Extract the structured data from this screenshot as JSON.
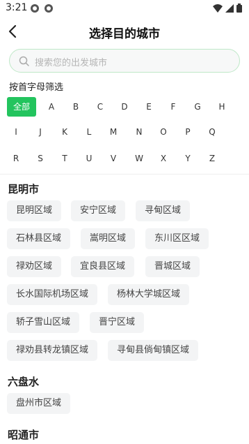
{
  "status": {
    "time": "3:21"
  },
  "header": {
    "title": "选择目的城市"
  },
  "search": {
    "placeholder": "搜索您的出发城市"
  },
  "filter": {
    "title": "按首字母筛选",
    "all_label": "全部",
    "letters": [
      "A",
      "B",
      "C",
      "D",
      "E",
      "F",
      "G",
      "H",
      "I",
      "J",
      "K",
      "L",
      "M",
      "N",
      "O",
      "P",
      "Q",
      "R",
      "S",
      "T",
      "U",
      "V",
      "W",
      "X",
      "Y",
      "Z"
    ]
  },
  "regions": [
    {
      "name": "昆明市",
      "areas": [
        "昆明区域",
        "安宁区域",
        "寻甸区域",
        "石林县区域",
        "嵩明区域",
        "东川区区域",
        "禄劝区域",
        "宜良县区域",
        "晋城区域",
        "长水国际机场区域",
        "杨林大学城区域",
        "轿子雪山区域",
        "晋宁区域",
        "禄劝县转龙镇区域",
        "寻甸县倘甸镇区域"
      ]
    },
    {
      "name": "六盘水",
      "areas": [
        "盘州市区域"
      ]
    },
    {
      "name": "昭通市",
      "areas": []
    }
  ],
  "colors": {
    "accent": "#23c45e",
    "chip_bg": "#f3f4f5",
    "search_border": "#bfe8c8"
  }
}
